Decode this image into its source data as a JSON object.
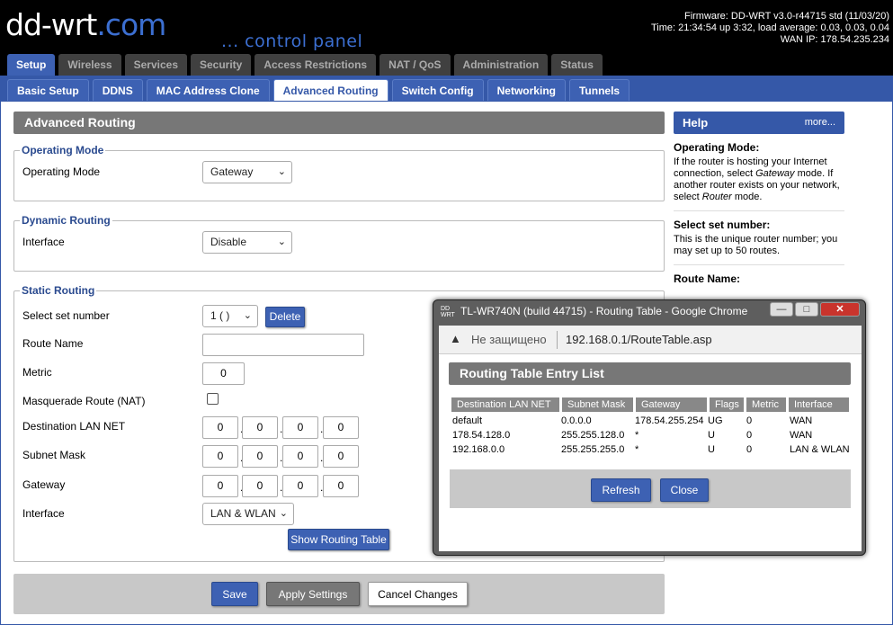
{
  "header": {
    "logo_main": "dd-wrt",
    "logo_tld": ".com",
    "tagline": "... control panel",
    "firmware": "Firmware: DD-WRT v3.0-r44715 std (11/03/20)",
    "time": "Time: 21:34:54 up 3:32, load average: 0.03, 0.03, 0.04",
    "wan_ip": "WAN IP: 178.54.235.234"
  },
  "main_tabs": [
    "Setup",
    "Wireless",
    "Services",
    "Security",
    "Access Restrictions",
    "NAT / QoS",
    "Administration",
    "Status"
  ],
  "sub_tabs": [
    "Basic Setup",
    "DDNS",
    "MAC Address Clone",
    "Advanced Routing",
    "Switch Config",
    "Networking",
    "Tunnels"
  ],
  "page_title": "Advanced Routing",
  "operating_mode": {
    "legend": "Operating Mode",
    "label": "Operating Mode",
    "value": "Gateway"
  },
  "dynamic_routing": {
    "legend": "Dynamic Routing",
    "label": "Interface",
    "value": "Disable"
  },
  "static_routing": {
    "legend": "Static Routing",
    "set_number_label": "Select set number",
    "set_number_value": "1 ( )",
    "delete_label": "Delete",
    "route_name_label": "Route Name",
    "route_name_value": "",
    "metric_label": "Metric",
    "metric_value": "0",
    "masquerade_label": "Masquerade Route (NAT)",
    "dest_label": "Destination LAN NET",
    "dest_ip": [
      "0",
      "0",
      "0",
      "0"
    ],
    "mask_label": "Subnet Mask",
    "mask_ip": [
      "0",
      "0",
      "0",
      "0"
    ],
    "gateway_label": "Gateway",
    "gateway_ip": [
      "0",
      "0",
      "0",
      "0"
    ],
    "interface_label": "Interface",
    "interface_value": "LAN & WLAN",
    "show_table_label": "Show Routing Table"
  },
  "footer": {
    "save": "Save",
    "apply": "Apply Settings",
    "cancel": "Cancel Changes"
  },
  "help": {
    "title": "Help",
    "more": "more...",
    "items": [
      {
        "title": "Operating Mode:",
        "text_before": "If the router is hosting your Internet connection, select ",
        "em1": "Gateway",
        "text_mid": " mode. If another router exists on your network, select ",
        "em2": "Router",
        "text_after": " mode."
      },
      {
        "title": "Select set number:",
        "text": "This is the unique router number; you may set up to 50 routes."
      },
      {
        "title": "Route Name:"
      }
    ]
  },
  "popup": {
    "window_title": "TL-WR740N (build 44715) - Routing Table - Google Chrome",
    "icon_text": "DD WRT",
    "insecure_label": "Не защищено",
    "url": "192.168.0.1/RouteTable.asp",
    "table_title": "Routing Table Entry List",
    "headers": [
      "Destination LAN NET",
      "Subnet Mask",
      "Gateway",
      "Flags",
      "Metric",
      "Interface"
    ],
    "rows": [
      [
        "default",
        "0.0.0.0",
        "178.54.255.254",
        "UG",
        "0",
        "WAN"
      ],
      [
        "178.54.128.0",
        "255.255.128.0",
        "*",
        "U",
        "0",
        "WAN"
      ],
      [
        "192.168.0.0",
        "255.255.255.0",
        "*",
        "U",
        "0",
        "LAN & WLAN"
      ]
    ],
    "refresh": "Refresh",
    "close": "Close"
  }
}
